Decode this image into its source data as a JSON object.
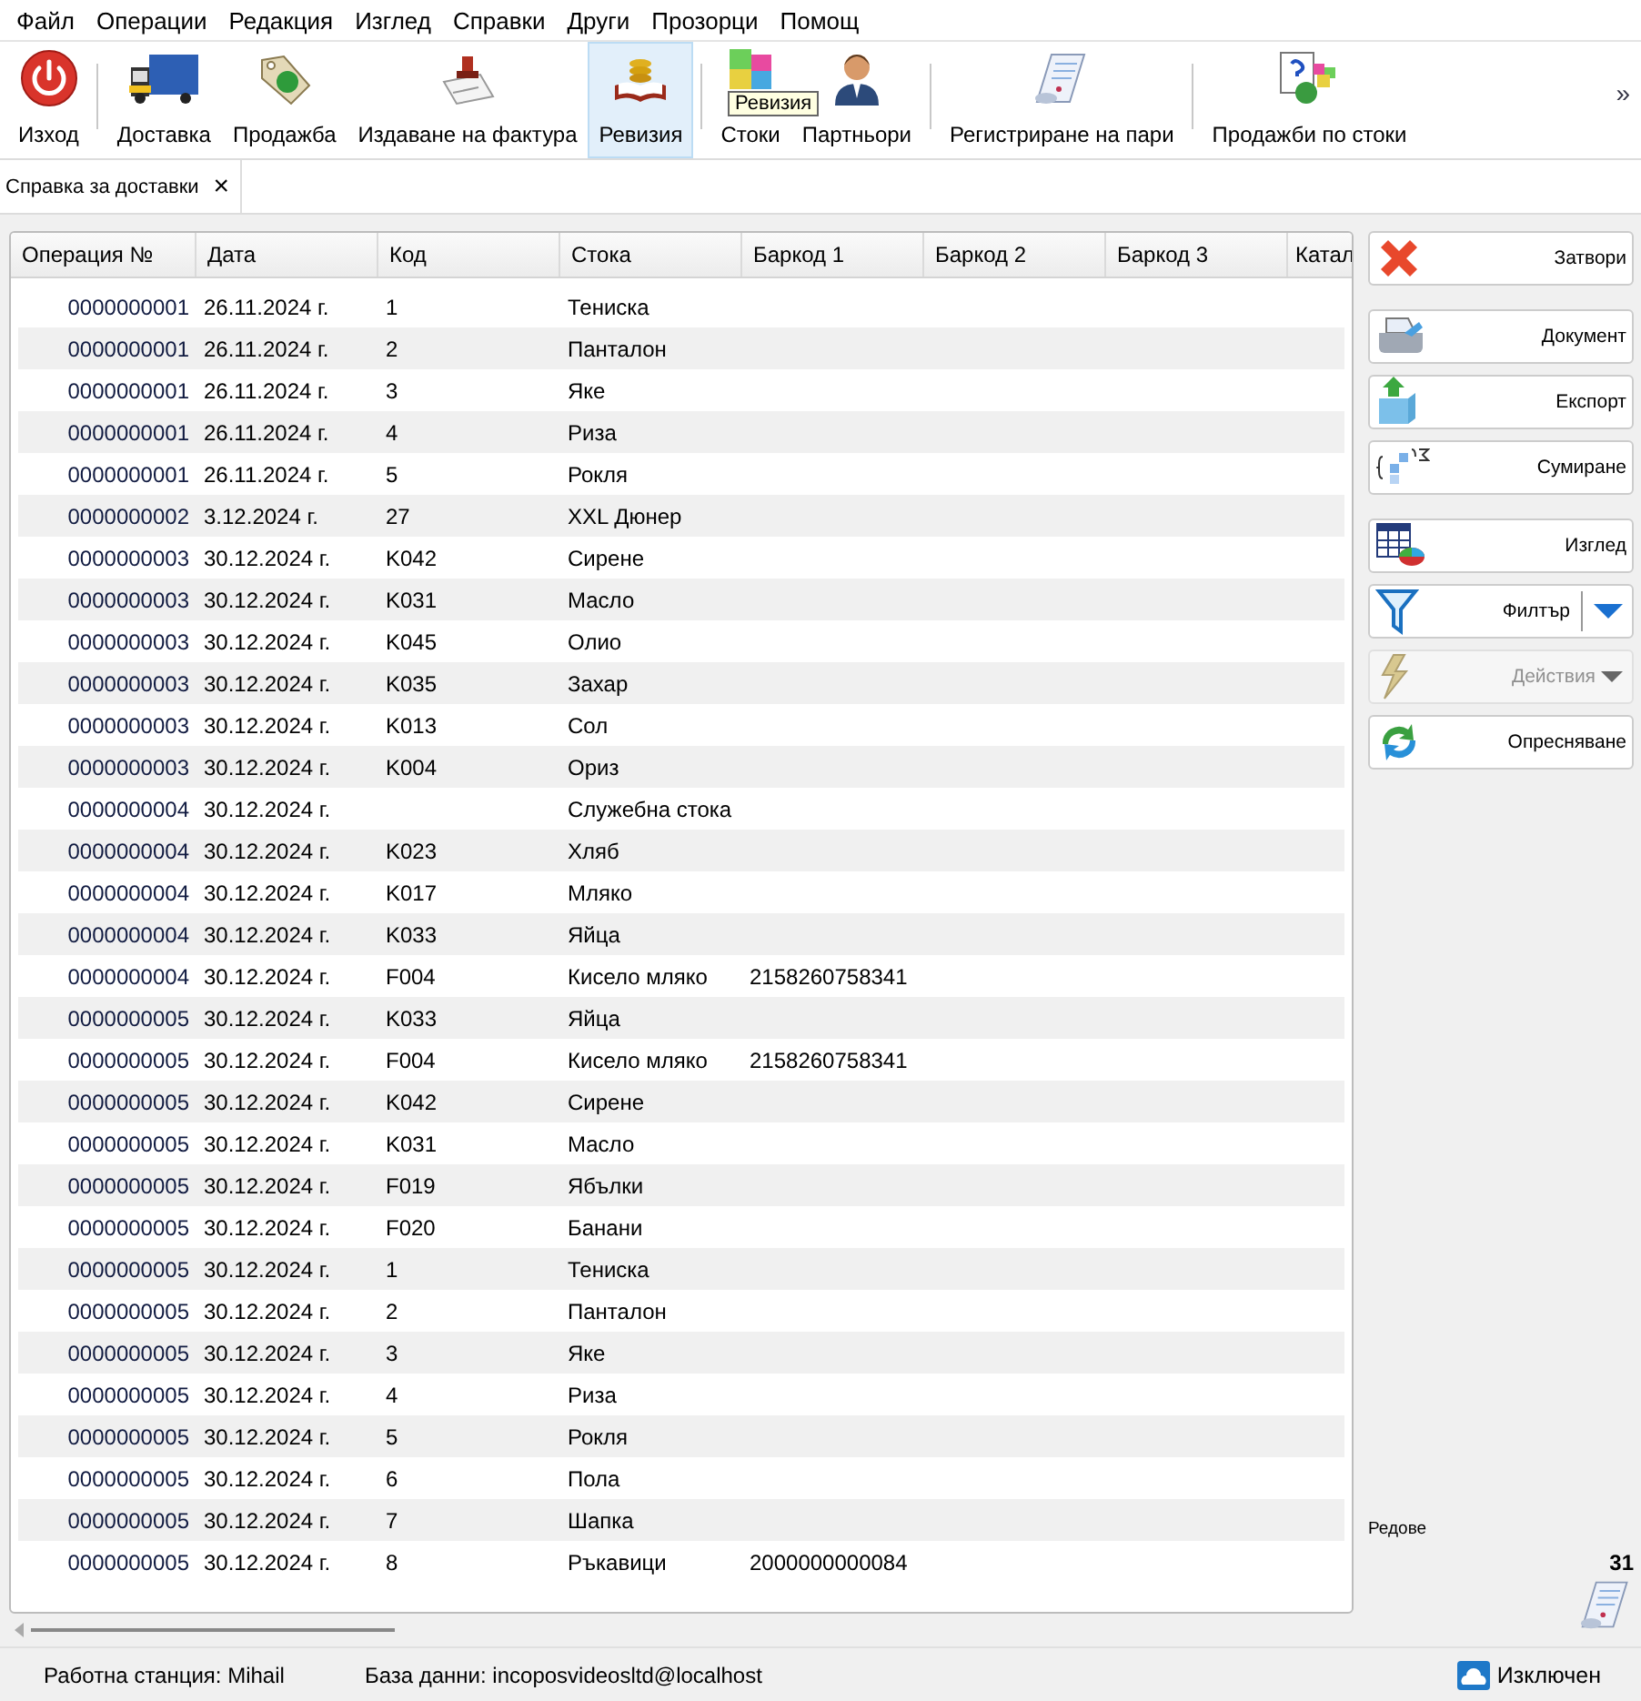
{
  "menu": [
    "Файл",
    "Операции",
    "Редакция",
    "Изглед",
    "Справки",
    "Други",
    "Прозорци",
    "Помощ"
  ],
  "toolbar": [
    {
      "kind": "button",
      "label": "Изход",
      "selected": false
    },
    {
      "kind": "separator"
    },
    {
      "kind": "button",
      "label": "Доставка",
      "selected": false
    },
    {
      "kind": "button",
      "label": "Продажба",
      "selected": false
    },
    {
      "kind": "button",
      "label": "Издаване на фактура",
      "selected": false
    },
    {
      "kind": "button",
      "label": "Ревизия",
      "selected": true
    },
    {
      "kind": "separator"
    },
    {
      "kind": "button",
      "label": "Стоки",
      "selected": false
    },
    {
      "kind": "button",
      "label": "Партньори",
      "selected": false
    },
    {
      "kind": "separator"
    },
    {
      "kind": "button",
      "label": "Регистриране на пари",
      "selected": false
    },
    {
      "kind": "separator"
    },
    {
      "kind": "button",
      "label": "Продажби по стоки",
      "selected": false
    }
  ],
  "toolbar_overflow": "»",
  "tooltip": "Ревизия",
  "document_tabs": [
    {
      "label": "Справка за доставки",
      "selected": true,
      "close": "×"
    }
  ],
  "table": {
    "columns": [
      "Операция №",
      "Дата",
      "Код",
      "Стока",
      "Баркод 1",
      "Баркод 2",
      "Баркод 3",
      "Катал"
    ],
    "rows": [
      {
        "operation": "0000000001",
        "date": "26.11.2024 г.",
        "code": "1",
        "item": "Тениска"
      },
      {
        "operation": "0000000001",
        "date": "26.11.2024 г.",
        "code": "2",
        "item": "Панталон"
      },
      {
        "operation": "0000000001",
        "date": "26.11.2024 г.",
        "code": "3",
        "item": "Яке"
      },
      {
        "operation": "0000000001",
        "date": "26.11.2024 г.",
        "code": "4",
        "item": "Риза"
      },
      {
        "operation": "0000000001",
        "date": "26.11.2024 г.",
        "code": "5",
        "item": "Рокля"
      },
      {
        "operation": "0000000002",
        "date": "3.12.2024 г.",
        "code": "27",
        "item": "XXL Дюнер"
      },
      {
        "operation": "0000000003",
        "date": "30.12.2024 г.",
        "code": "K042",
        "item": "Сирене"
      },
      {
        "operation": "0000000003",
        "date": "30.12.2024 г.",
        "code": "K031",
        "item": "Масло"
      },
      {
        "operation": "0000000003",
        "date": "30.12.2024 г.",
        "code": "K045",
        "item": "Олио"
      },
      {
        "operation": "0000000003",
        "date": "30.12.2024 г.",
        "code": "K035",
        "item": "Захар"
      },
      {
        "operation": "0000000003",
        "date": "30.12.2024 г.",
        "code": "K013",
        "item": "Сол"
      },
      {
        "operation": "0000000003",
        "date": "30.12.2024 г.",
        "code": "K004",
        "item": "Ориз"
      },
      {
        "operation": "0000000004",
        "date": "30.12.2024 г.",
        "item": "Служебна стока"
      },
      {
        "operation": "0000000004",
        "date": "30.12.2024 г.",
        "code": "K023",
        "item": "Хляб"
      },
      {
        "operation": "0000000004",
        "date": "30.12.2024 г.",
        "code": "K017",
        "item": "Мляко"
      },
      {
        "operation": "0000000004",
        "date": "30.12.2024 г.",
        "code": "K033",
        "item": "Яйца"
      },
      {
        "operation": "0000000004",
        "date": "30.12.2024 г.",
        "code": "F004",
        "item": "Кисело мляко",
        "barcode_1": "2158260758341"
      },
      {
        "operation": "0000000005",
        "date": "30.12.2024 г.",
        "code": "K033",
        "item": "Яйца"
      },
      {
        "operation": "0000000005",
        "date": "30.12.2024 г.",
        "code": "F004",
        "item": "Кисело мляко",
        "barcode_1": "2158260758341"
      },
      {
        "operation": "0000000005",
        "date": "30.12.2024 г.",
        "code": "K042",
        "item": "Сирене"
      },
      {
        "operation": "0000000005",
        "date": "30.12.2024 г.",
        "code": "K031",
        "item": "Масло"
      },
      {
        "operation": "0000000005",
        "date": "30.12.2024 г.",
        "code": "F019",
        "item": "Ябълки"
      },
      {
        "operation": "0000000005",
        "date": "30.12.2024 г.",
        "code": "F020",
        "item": "Банани"
      },
      {
        "operation": "0000000005",
        "date": "30.12.2024 г.",
        "code": "1",
        "item": "Тениска"
      },
      {
        "operation": "0000000005",
        "date": "30.12.2024 г.",
        "code": "2",
        "item": "Панталон"
      },
      {
        "operation": "0000000005",
        "date": "30.12.2024 г.",
        "code": "3",
        "item": "Яке"
      },
      {
        "operation": "0000000005",
        "date": "30.12.2024 г.",
        "code": "4",
        "item": "Риза"
      },
      {
        "operation": "0000000005",
        "date": "30.12.2024 г.",
        "code": "5",
        "item": "Рокля"
      },
      {
        "operation": "0000000005",
        "date": "30.12.2024 г.",
        "code": "6",
        "item": "Пола"
      },
      {
        "operation": "0000000005",
        "date": "30.12.2024 г.",
        "code": "7",
        "item": "Шапка"
      },
      {
        "operation": "0000000005",
        "date": "30.12.2024 г.",
        "code": "8",
        "item": "Ръкавици",
        "barcode_1": "2000000000084"
      }
    ]
  },
  "side_panel": {
    "groups": [
      [
        {
          "kind": "plain",
          "label": "Затвори",
          "disabled": false
        }
      ],
      [
        {
          "kind": "plain",
          "label": "Документ",
          "disabled": false
        },
        {
          "kind": "plain",
          "label": "Експорт",
          "disabled": false
        },
        {
          "kind": "plain",
          "label": "Сумиране",
          "disabled": false
        }
      ],
      [
        {
          "kind": "plain",
          "label": "Изглед",
          "disabled": false
        },
        {
          "kind": "split",
          "label": "Филтър",
          "disabled": false
        },
        {
          "kind": "dropdown",
          "label": "Действия",
          "disabled": true
        },
        {
          "kind": "plain",
          "label": "Опресняване",
          "disabled": false
        }
      ]
    ],
    "rows_label": "Редове",
    "rows_count": "31"
  },
  "status_bar": {
    "workstation": "Работна станция: Mihail",
    "database": "База данни: incoposvideosltd@localhost",
    "connection": "Изключен"
  }
}
